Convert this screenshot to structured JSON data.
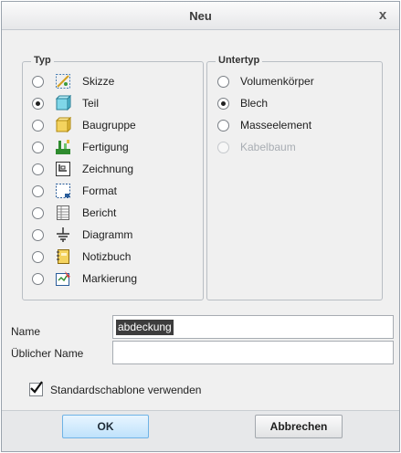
{
  "dialog": {
    "title": "Neu",
    "close_label": "x"
  },
  "typ": {
    "legend": "Typ",
    "items": [
      {
        "label": "Skizze",
        "icon": "sketch-icon",
        "selected": false
      },
      {
        "label": "Teil",
        "icon": "part-icon",
        "selected": true
      },
      {
        "label": "Baugruppe",
        "icon": "assembly-icon",
        "selected": false
      },
      {
        "label": "Fertigung",
        "icon": "manufacturing-icon",
        "selected": false
      },
      {
        "label": "Zeichnung",
        "icon": "drawing-icon",
        "selected": false
      },
      {
        "label": "Format",
        "icon": "format-icon",
        "selected": false
      },
      {
        "label": "Bericht",
        "icon": "report-icon",
        "selected": false
      },
      {
        "label": "Diagramm",
        "icon": "diagram-icon",
        "selected": false
      },
      {
        "label": "Notizbuch",
        "icon": "notebook-icon",
        "selected": false
      },
      {
        "label": "Markierung",
        "icon": "markup-icon",
        "selected": false
      }
    ]
  },
  "untertyp": {
    "legend": "Untertyp",
    "items": [
      {
        "label": "Volumenkörper",
        "selected": false,
        "disabled": false
      },
      {
        "label": "Blech",
        "selected": true,
        "disabled": false
      },
      {
        "label": "Masseelement",
        "selected": false,
        "disabled": false
      },
      {
        "label": "Kabelbaum",
        "selected": false,
        "disabled": true
      }
    ]
  },
  "fields": {
    "name_label": "Name",
    "name_value": "abdeckung",
    "common_name_label": "Üblicher Name",
    "common_name_value": ""
  },
  "options": {
    "use_template_label": "Standardschablone verwenden",
    "use_template_checked": true
  },
  "buttons": {
    "ok": "OK",
    "cancel": "Abbrechen"
  },
  "colors": {
    "ok_button": "#bfe2fb",
    "selection_bg": "#3d3d3d"
  }
}
